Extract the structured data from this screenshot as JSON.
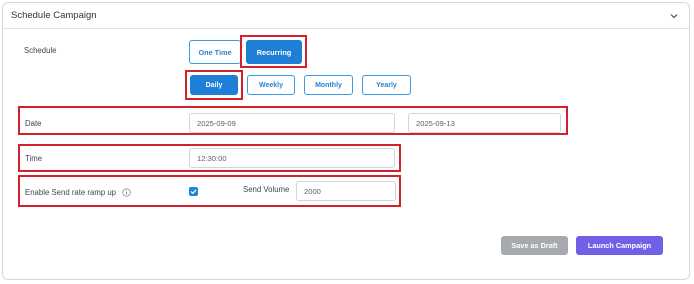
{
  "panel": {
    "title": "Schedule Campaign",
    "icon": "chevron-down-icon"
  },
  "schedule": {
    "label": "Schedule",
    "options": [
      "One Time",
      "Recurring"
    ],
    "selected": "Recurring"
  },
  "frequency": {
    "options": [
      "Daily",
      "Weekly",
      "Monthly",
      "Yearly"
    ],
    "selected": "Daily"
  },
  "date": {
    "label": "Date",
    "start": "2025-09-09",
    "end": "2025-09-13"
  },
  "time": {
    "label": "Time",
    "value": "12:30:00"
  },
  "ramp": {
    "label": "Enable Send rate ramp up",
    "info_icon": "info-icon",
    "checked": true,
    "volume_label": "Send Volume",
    "volume_value": "2000"
  },
  "actions": {
    "draft": "Save as Draft",
    "launch": "Launch Campaign"
  },
  "colors": {
    "primary": "#1f7fd6",
    "launch": "#7060e8",
    "draft": "#a6a9ad",
    "highlight": "#d3202a"
  }
}
